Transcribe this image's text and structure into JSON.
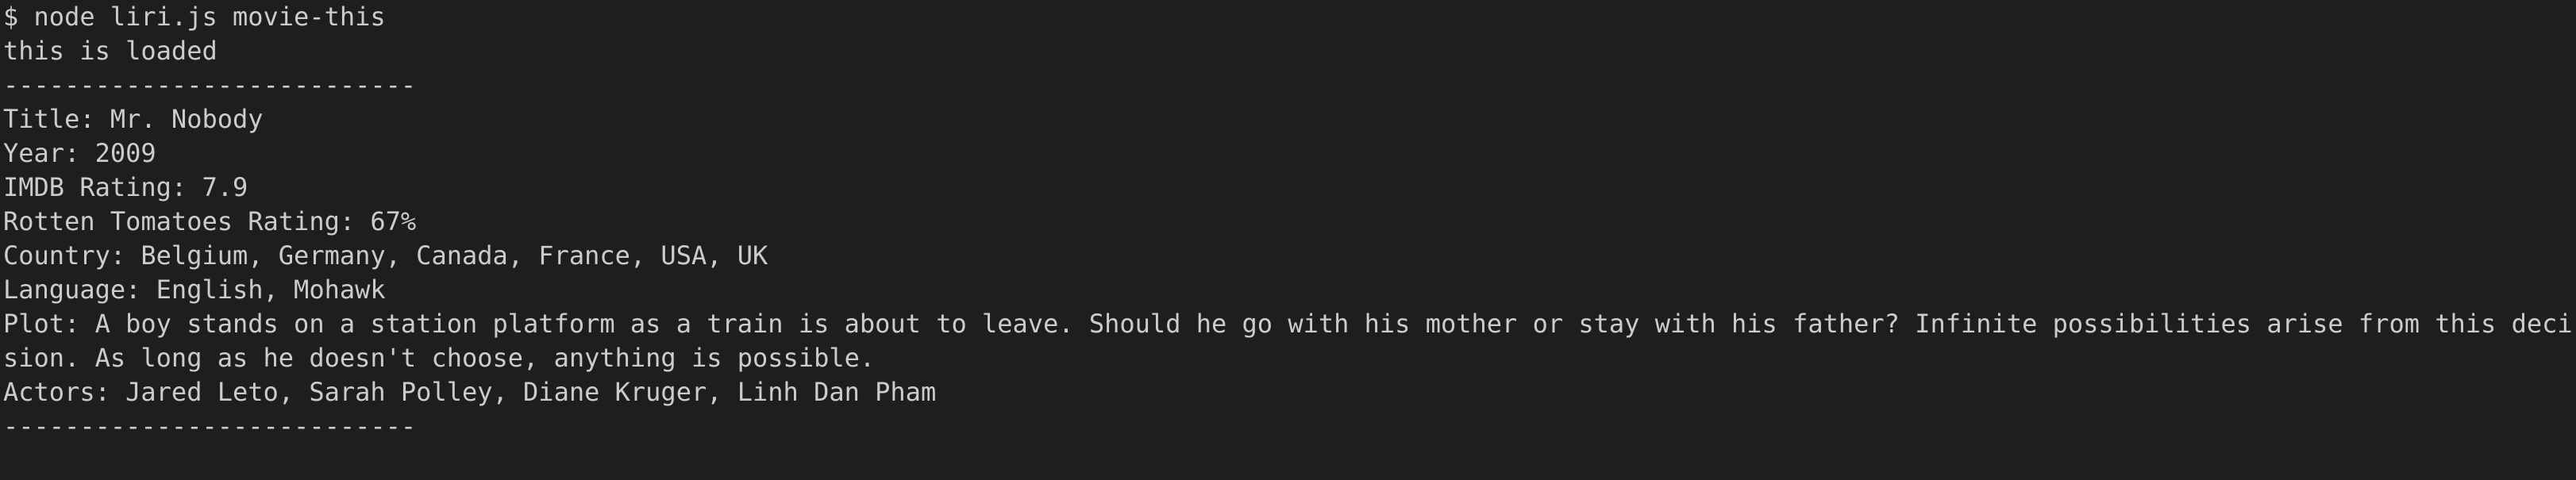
{
  "terminal": {
    "lines": [
      "$ node liri.js movie-this",
      "this is loaded",
      "---------------------------",
      "Title: Mr. Nobody",
      "Year: 2009",
      "IMDB Rating: 7.9",
      "Rotten Tomatoes Rating: 67%",
      "Country: Belgium, Germany, Canada, France, USA, UK",
      "Language: English, Mohawk",
      "Plot: A boy stands on a station platform as a train is about to leave. Should he go with his mother or stay with his father? Infinite possibilities arise from this deci",
      "sion. As long as he doesn't choose, anything is possible.",
      "Actors: Jared Leto, Sarah Polley, Diane Kruger, Linh Dan Pham",
      "---------------------------"
    ]
  },
  "colors": {
    "background": "#1e1e1e",
    "text": "#cccccc"
  }
}
